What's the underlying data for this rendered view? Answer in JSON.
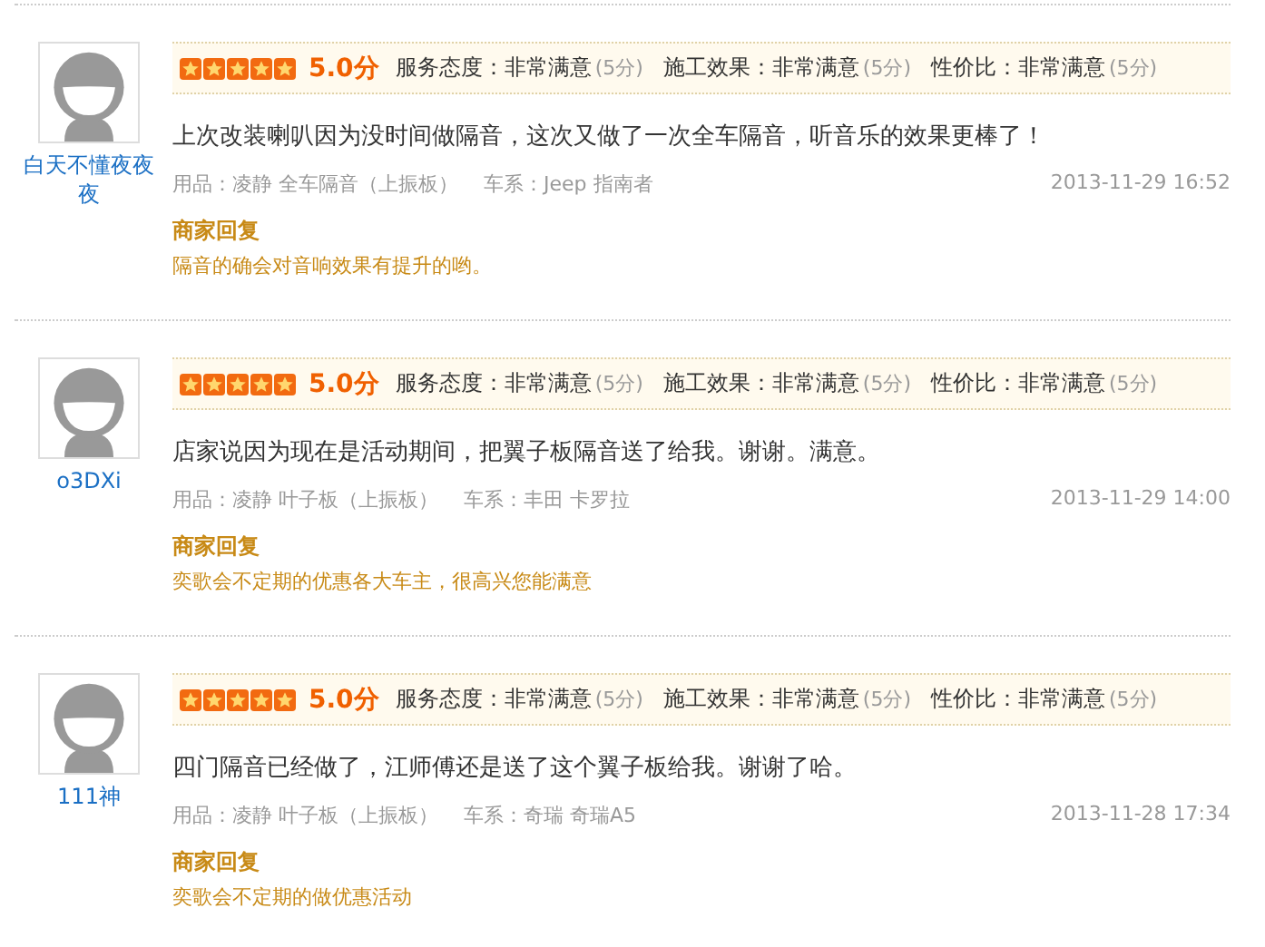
{
  "reviews": [
    {
      "user": {
        "name": "白天不懂夜夜夜"
      },
      "stars": 5,
      "score": "5.0分",
      "criteria": [
        {
          "label": "服务态度：非常满意",
          "points": "(5分)"
        },
        {
          "label": "施工效果：非常满意",
          "points": "(5分)"
        },
        {
          "label": "性价比：非常满意",
          "points": "(5分)"
        }
      ],
      "comment": "上次改装喇叭因为没时间做隔音，这次又做了一次全车隔音，听音乐的效果更棒了！",
      "product": "用品：凌静 全车隔音（上振板）",
      "car": "车系：Jeep 指南者",
      "time": "2013-11-29 16:52",
      "reply": {
        "title": "商家回复",
        "text": "隔音的确会对音响效果有提升的哟。"
      }
    },
    {
      "user": {
        "name": "o3DXi"
      },
      "stars": 5,
      "score": "5.0分",
      "criteria": [
        {
          "label": "服务态度：非常满意",
          "points": "(5分)"
        },
        {
          "label": "施工效果：非常满意",
          "points": "(5分)"
        },
        {
          "label": "性价比：非常满意",
          "points": "(5分)"
        }
      ],
      "comment": "店家说因为现在是活动期间，把翼子板隔音送了给我。谢谢。满意。",
      "product": "用品：凌静 叶子板（上振板）",
      "car": "车系：丰田 卡罗拉",
      "time": "2013-11-29 14:00",
      "reply": {
        "title": "商家回复",
        "text": "奕歌会不定期的优惠各大车主，很高兴您能满意"
      }
    },
    {
      "user": {
        "name": "111神"
      },
      "stars": 5,
      "score": "5.0分",
      "criteria": [
        {
          "label": "服务态度：非常满意",
          "points": "(5分)"
        },
        {
          "label": "施工效果：非常满意",
          "points": "(5分)"
        },
        {
          "label": "性价比：非常满意",
          "points": "(5分)"
        }
      ],
      "comment": "四门隔音已经做了，江师傅还是送了这个翼子板给我。谢谢了哈。",
      "product": "用品：凌静 叶子板（上振板）",
      "car": "车系：奇瑞 奇瑞A5",
      "time": "2013-11-28 17:34",
      "reply": {
        "title": "商家回复",
        "text": "奕歌会不定期的做优惠活动"
      }
    }
  ]
}
